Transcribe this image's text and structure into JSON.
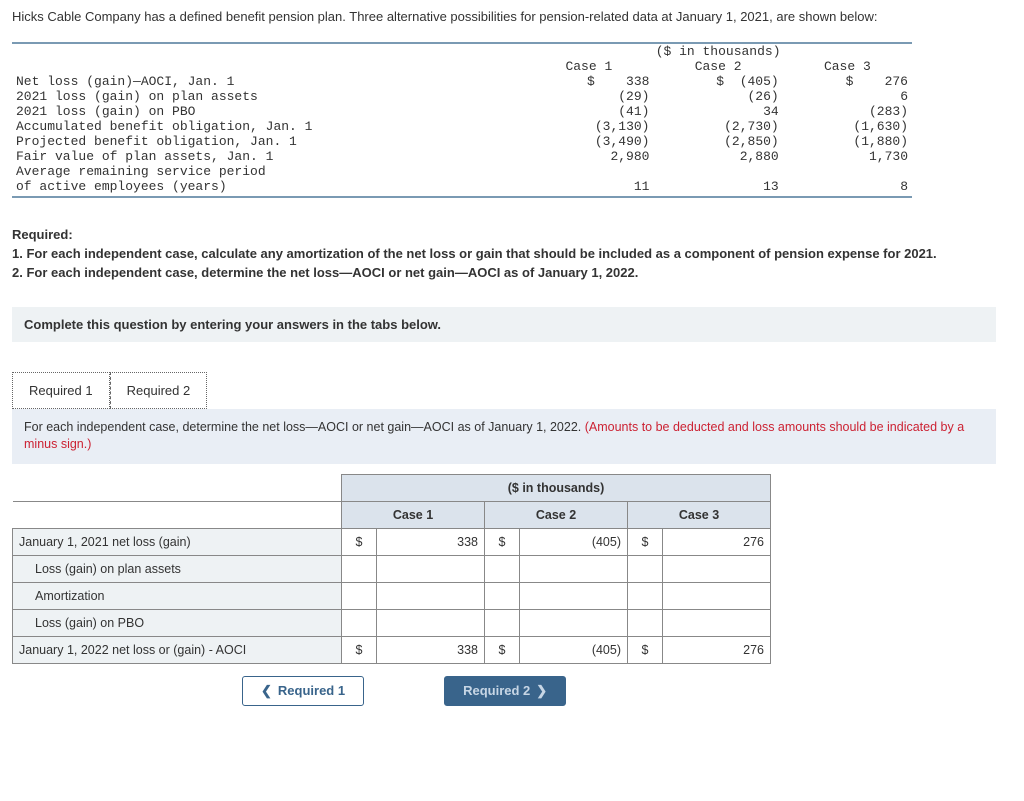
{
  "intro": "Hicks Cable Company has a defined benefit pension plan. Three alternative possibilities for pension-related data at January 1, 2021, are shown below:",
  "data_header_unit": "($ in thousands)",
  "cols": [
    "Case 1",
    "Case 2",
    "Case 3"
  ],
  "rows": [
    {
      "label": "Net loss (gain)—AOCI, Jan. 1",
      "c1": "$    338",
      "c2": "$  (405)",
      "c3": "$    276"
    },
    {
      "label": "2021 loss (gain) on plan assets",
      "c1": "(29)",
      "c2": "(26)",
      "c3": "6"
    },
    {
      "label": "2021 loss (gain) on PBO",
      "c1": "(41)",
      "c2": "34",
      "c3": "(283)"
    },
    {
      "label": "Accumulated benefit obligation, Jan. 1",
      "c1": "(3,130)",
      "c2": "(2,730)",
      "c3": "(1,630)"
    },
    {
      "label": "Projected benefit obligation, Jan. 1",
      "c1": "(3,490)",
      "c2": "(2,850)",
      "c3": "(1,880)"
    },
    {
      "label": "Fair value of plan assets, Jan. 1",
      "c1": "2,980",
      "c2": "2,880",
      "c3": "1,730"
    },
    {
      "label": "Average remaining service period",
      "c1": "",
      "c2": "",
      "c3": ""
    },
    {
      "label": "of active employees (years)",
      "c1": "11",
      "c2": "13",
      "c3": "8"
    }
  ],
  "required_title": "Required:",
  "required_1": "1. For each independent case, calculate any amortization of the net loss or gain that should be included as a component of pension expense for 2021.",
  "required_2": "2. For each independent case, determine the net loss—AOCI or net gain—AOCI as of January 1, 2022.",
  "instr": "Complete this question by entering your answers in the tabs below.",
  "tabs": {
    "t1": "Required 1",
    "t2": "Required 2"
  },
  "tab2_text_black": "For each independent case, determine the net loss—AOCI or net gain—AOCI as of January 1, 2022. ",
  "tab2_text_red": "(Amounts to be deducted and loss amounts should be indicated by a minus sign.)",
  "ans_header_unit": "($ in thousands)",
  "ans_cols": [
    "Case 1",
    "Case 2",
    "Case 3"
  ],
  "ans_rows": [
    {
      "label": "January 1, 2021 net loss (gain)",
      "indent": false,
      "c1": {
        "s": "$",
        "v": "338"
      },
      "c2": {
        "s": "$",
        "v": "(405)"
      },
      "c3": {
        "s": "$",
        "v": "276"
      }
    },
    {
      "label": "Loss (gain) on plan assets",
      "indent": true,
      "c1": {
        "s": "",
        "v": ""
      },
      "c2": {
        "s": "",
        "v": ""
      },
      "c3": {
        "s": "",
        "v": ""
      }
    },
    {
      "label": "Amortization",
      "indent": true,
      "c1": {
        "s": "",
        "v": ""
      },
      "c2": {
        "s": "",
        "v": ""
      },
      "c3": {
        "s": "",
        "v": ""
      }
    },
    {
      "label": "Loss (gain) on PBO",
      "indent": true,
      "c1": {
        "s": "",
        "v": ""
      },
      "c2": {
        "s": "",
        "v": ""
      },
      "c3": {
        "s": "",
        "v": ""
      }
    },
    {
      "label": "January 1, 2022 net loss or (gain) - AOCI",
      "indent": false,
      "sum": true,
      "c1": {
        "s": "$",
        "v": "338"
      },
      "c2": {
        "s": "$",
        "v": "(405)"
      },
      "c3": {
        "s": "$",
        "v": "276"
      }
    }
  ],
  "nav": {
    "prev": "Required 1",
    "next": "Required 2"
  }
}
